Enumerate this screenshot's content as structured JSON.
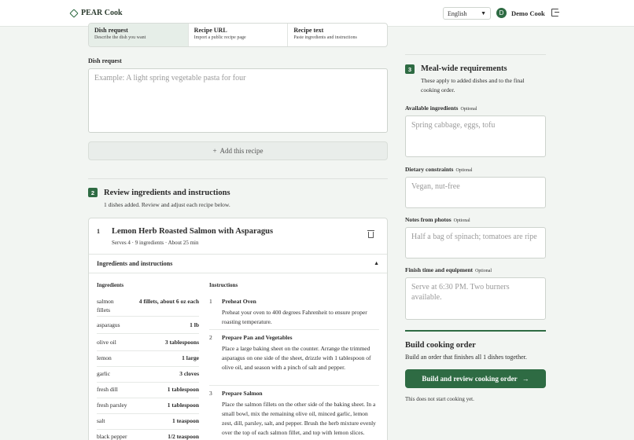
{
  "header": {
    "brand": "PEAR Cook",
    "language": "English",
    "avatar_initial": "D",
    "username": "Demo Cook"
  },
  "tabs": [
    {
      "title": "Dish request",
      "desc": "Describe the dish you want"
    },
    {
      "title": "Recipe URL",
      "desc": "Import a public recipe page"
    },
    {
      "title": "Recipe text",
      "desc": "Paste ingredients and instructions"
    }
  ],
  "dish_request": {
    "label": "Dish request",
    "placeholder": "Example: A light spring vegetable pasta for four",
    "add_button": "Add this recipe"
  },
  "review": {
    "step": "2",
    "title": "Review ingredients and instructions",
    "count": "1",
    "subtitle": "dishes added. Review and adjust each recipe below."
  },
  "recipe": {
    "index": "1",
    "title": "Lemon Herb Roasted Salmon with Asparagus",
    "serves": "Serves 4",
    "ingredients_count": "9 ingredients",
    "time": "About 25 min",
    "toggle_label": "Ingredients and instructions",
    "ingredients_heading": "Ingredients",
    "instructions_heading": "Instructions",
    "ingredients": [
      {
        "name": "salmon fillets",
        "qty": "4 fillets, about 6 oz each"
      },
      {
        "name": "asparagus",
        "qty": "1 lb"
      },
      {
        "name": "olive oil",
        "qty": "3 tablespoons"
      },
      {
        "name": "lemon",
        "qty": "1 large"
      },
      {
        "name": "garlic",
        "qty": "3 cloves"
      },
      {
        "name": "fresh dill",
        "qty": "1 tablespoon"
      },
      {
        "name": "fresh parsley",
        "qty": "1 tablespoon"
      },
      {
        "name": "salt",
        "qty": "1 teaspoon"
      },
      {
        "name": "black pepper",
        "qty": "1/2 teaspoon"
      }
    ],
    "instructions": [
      {
        "n": "1",
        "title": "Preheat Oven",
        "body": "Preheat your oven to 400 degrees Fahrenheit to ensure proper roasting temperature."
      },
      {
        "n": "2",
        "title": "Prepare Pan and Vegetables",
        "body": "Place a large baking sheet on the counter. Arrange the trimmed asparagus on one side of the sheet, drizzle with 1 tablespoon of olive oil, and season with a pinch of salt and pepper."
      },
      {
        "n": "3",
        "title": "Prepare Salmon",
        "body": "Place the salmon fillets on the other side of the baking sheet. In a small bowl, mix the remaining olive oil, minced garlic, lemon zest, dill, parsley, salt, and pepper. Brush the herb mixture evenly over the top of each salmon fillet, and top with lemon slices."
      }
    ]
  },
  "requirements": {
    "step": "3",
    "title": "Meal-wide requirements",
    "subtitle": "These apply to added dishes and to the final cooking order.",
    "optional_label": "Optional",
    "fields": [
      {
        "label": "Available ingredients",
        "placeholder": "Spring cabbage, eggs, tofu"
      },
      {
        "label": "Dietary constraints",
        "placeholder": "Vegan, nut-free"
      },
      {
        "label": "Notes from photos",
        "placeholder": "Half a bag of spinach; tomatoes are ripe"
      },
      {
        "label": "Finish time and equipment",
        "placeholder": "Serve at 6:30 PM. Two burners available."
      }
    ]
  },
  "build": {
    "title": "Build cooking order",
    "subtitle": "Build an order that finishes all 1 dishes together.",
    "button": "Build and review cooking order",
    "note": "This does not start cooking yet."
  },
  "colors": {
    "accent": "#2e6b43",
    "background": "#f2f5f2"
  }
}
